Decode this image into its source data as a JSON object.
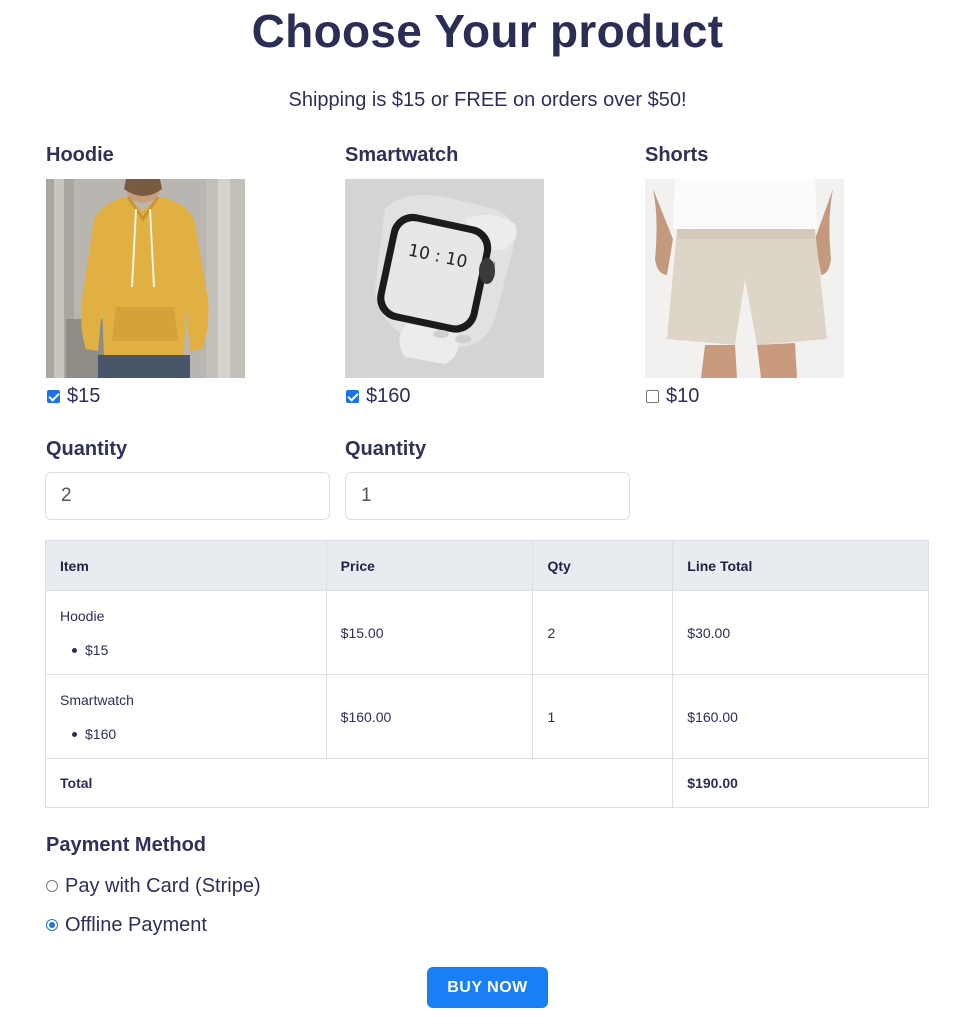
{
  "page": {
    "title": "Choose Your product",
    "subtitle": "Shipping is $15 or FREE on orders over $50!"
  },
  "products": [
    {
      "name": "Hoodie",
      "price": "$15",
      "checked": true,
      "image": "man-in-yellow-hoodie-photo"
    },
    {
      "name": "Smartwatch",
      "price": "$160",
      "checked": true,
      "image": "white-smartwatch-photo",
      "watch_face": "10 : 10"
    },
    {
      "name": "Shorts",
      "price": "$10",
      "checked": false,
      "image": "beige-shorts-photo"
    }
  ],
  "quantity": [
    {
      "label": "Quantity",
      "value": "2"
    },
    {
      "label": "Quantity",
      "value": "1"
    }
  ],
  "order_table": {
    "headers": [
      "Item",
      "Price",
      "Qty",
      "Line Total"
    ],
    "rows": [
      {
        "item": "Hoodie",
        "option": "$15",
        "price": "$15.00",
        "qty": "2",
        "line_total": "$30.00"
      },
      {
        "item": "Smartwatch",
        "option": "$160",
        "price": "$160.00",
        "qty": "1",
        "line_total": "$160.00"
      }
    ],
    "total_label": "Total",
    "total_value": "$190.00"
  },
  "payment": {
    "title": "Payment Method",
    "options": [
      {
        "label": "Pay with Card (Stripe)",
        "selected": false
      },
      {
        "label": "Offline Payment",
        "selected": true
      }
    ]
  },
  "buy_button": "BUY NOW",
  "colors": {
    "text": "#2b2f5a",
    "accent": "#1a73e8",
    "button": "#1a7ff5",
    "table_header": "#e8ebef"
  }
}
